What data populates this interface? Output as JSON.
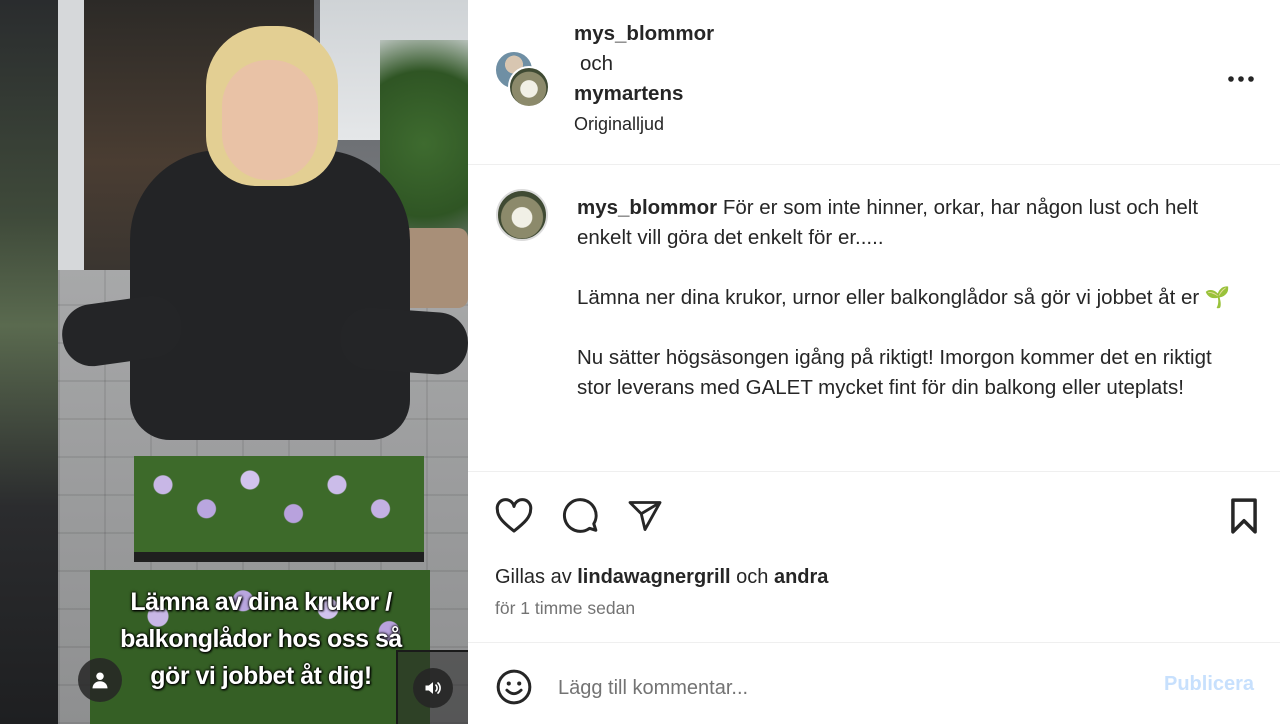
{
  "video": {
    "caption_lines": [
      "Lämna av dina krukor /",
      "balkonglådor hos oss så",
      "gör vi jobbet åt dig!"
    ]
  },
  "header": {
    "author1": "mys_blommor",
    "conjunction": "och",
    "author2": "mymartens",
    "audio": "Originalljud"
  },
  "caption": {
    "username": "mys_blommor",
    "text": " För er som inte hinner, orkar, har någon lust och helt enkelt vill göra det enkelt för er.....\n\nLämna ner dina krukor, urnor eller balkonglådor så gör vi jobbet åt er 🌱\n\nNu sätter högsäsongen igång på riktigt! Imorgon kommer det en riktigt stor leverans med GALET mycket fint för din balkong eller uteplats!"
  },
  "likes": {
    "prefix": "Gillas av ",
    "user": "lindawagnergrill",
    "middle": " och ",
    "others": "andra"
  },
  "timestamp": "för 1 timme sedan",
  "comment": {
    "placeholder": "Lägg till kommentar...",
    "publish_label": "Publicera"
  },
  "icons": {
    "like": "heart-icon",
    "comment": "comment-bubble-icon",
    "share": "paper-plane-icon",
    "save": "bookmark-icon",
    "more": "more-options-icon",
    "emoji": "emoji-icon",
    "user_tag": "user-icon",
    "audio": "speaker-icon"
  },
  "colors": {
    "text": "#262626",
    "muted": "#737373",
    "publish_disabled": "#c7e0fd",
    "divider": "#efefef"
  }
}
